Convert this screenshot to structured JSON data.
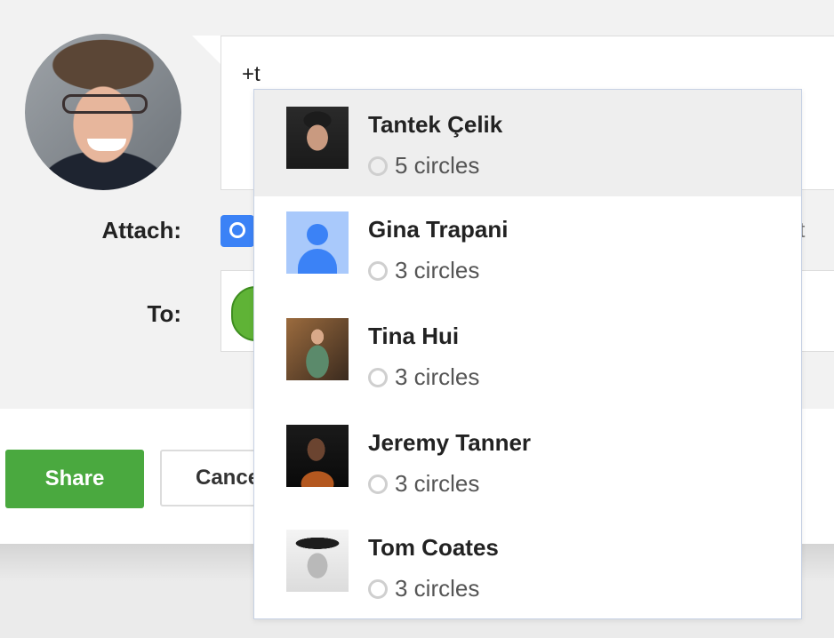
{
  "compose": {
    "post_text": "+t",
    "attach_label": "Attach:",
    "attach_more_partial": "ent",
    "to_label": "To:"
  },
  "actions": {
    "share_label": "Share",
    "cancel_label": "Cance"
  },
  "suggestions": [
    {
      "name": "Tantek Çelik",
      "circles": "5 circles",
      "selected": true
    },
    {
      "name": "Gina Trapani",
      "circles": "3 circles",
      "selected": false
    },
    {
      "name": "Tina Hui",
      "circles": "3 circles",
      "selected": false
    },
    {
      "name": "Jeremy Tanner",
      "circles": "3 circles",
      "selected": false
    },
    {
      "name": "Tom Coates",
      "circles": "3 circles",
      "selected": false
    }
  ],
  "colors": {
    "share_button": "#4aa93f",
    "camera_icon": "#3b82f6",
    "dropdown_border": "#c6d1e4",
    "selected_row": "#eeeeee"
  }
}
